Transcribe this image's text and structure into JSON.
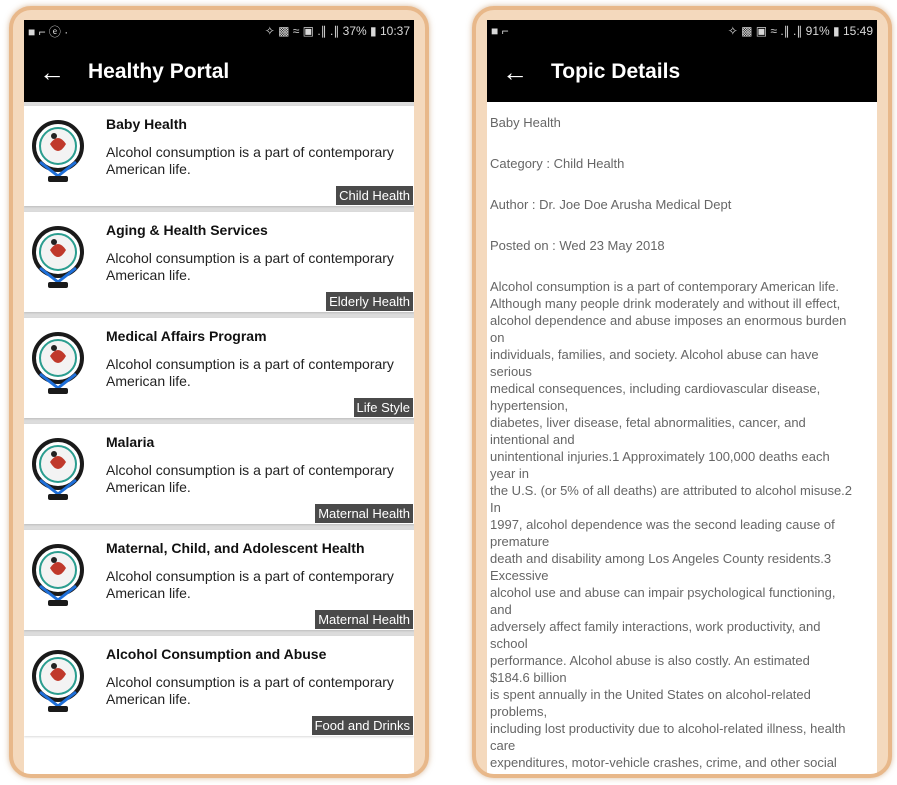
{
  "left": {
    "status": {
      "left": "■ ⌐ ⓔ ·",
      "right": "✧ ▩ ≈ ▣ .∥ .∥ 37% ▮ 10:37"
    },
    "title": "Healthy Portal",
    "items": [
      {
        "title": "Baby Health",
        "desc": "Alcohol consumption is a part of contemporary American life.",
        "category": "Child Health"
      },
      {
        "title": "Aging & Health Services",
        "desc": "Alcohol consumption is a part of contemporary American life.",
        "category": "Elderly Health"
      },
      {
        "title": "Medical Affairs Program",
        "desc": "Alcohol consumption is a part of contemporary American life.",
        "category": "Life Style"
      },
      {
        "title": "Malaria",
        "desc": "Alcohol consumption is a part of contemporary American life.",
        "category": "Maternal Health"
      },
      {
        "title": "Maternal, Child, and Adolescent Health",
        "desc": "Alcohol consumption is a part of contemporary American life.",
        "category": "Maternal Health"
      },
      {
        "title": "Alcohol Consumption and Abuse",
        "desc": "Alcohol consumption is a part of contemporary American life.",
        "category": "Food and Drinks"
      }
    ]
  },
  "right": {
    "status": {
      "left": "■ ⌐",
      "right": "✧ ▩ ▣ ≈ .∥ .∥ 91% ▮ 15:49"
    },
    "title": "Topic Details",
    "topic": "Baby Health",
    "category": "Category : Child Health",
    "author": "Author : Dr. Joe Doe Arusha Medical Dept",
    "posted": "Posted on : Wed 23 May 2018",
    "body": "Alcohol consumption is a part of contemporary American life.\nAlthough many people drink moderately and without ill effect,\nalcohol dependence and abuse imposes an enormous burden\non\nindividuals, families, and society. Alcohol abuse can have\nserious\nmedical consequences, including cardiovascular disease,\nhypertension,\ndiabetes, liver disease, fetal abnormalities, cancer, and\nintentional and\nunintentional injuries.1 Approximately 100,000 deaths each\nyear in\nthe U.S. (or 5% of all deaths) are attributed to alcohol misuse.2\nIn\n1997, alcohol dependence was the second leading cause of\npremature\ndeath and disability among Los Angeles County residents.3\nExcessive\nalcohol use and abuse can impair psychological functioning,\nand\nadversely affect family interactions, work productivity, and\nschool\nperformance. Alcohol abuse is also costly. An estimated\n$184.6 billion\nis spent annually in the United States on alcohol-related\nproblems,\nincluding lost productivity due to alcohol-related illness, health\ncare\nexpenditures, motor-vehicle crashes, crime, and other social"
  },
  "colors": {
    "appbar": "#000000",
    "badge": "#4a4a4a",
    "frame": "#e8b88a",
    "list_bg": "#dcdcdc"
  },
  "icons": {
    "back": "arrow-left-icon",
    "logo": "health-logo-icon"
  }
}
